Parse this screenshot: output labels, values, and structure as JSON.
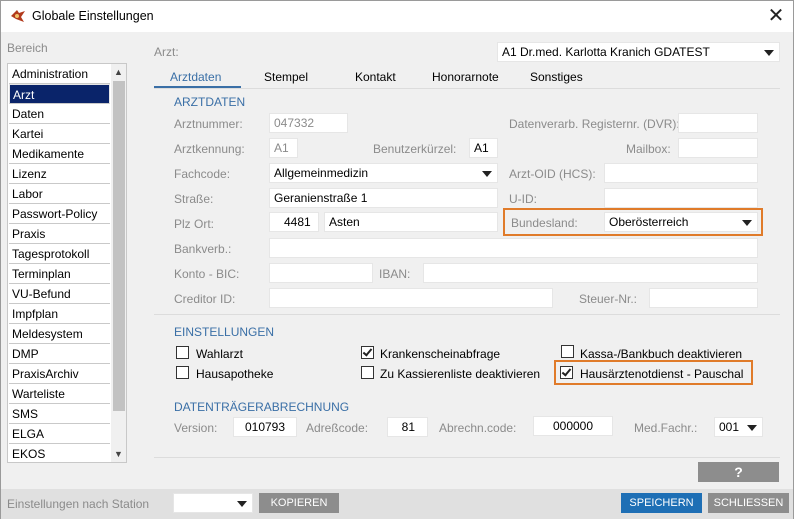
{
  "window": {
    "title": "Globale Einstellungen",
    "close_glyph": "✕"
  },
  "sidebar": {
    "heading": "Bereich",
    "items": [
      "Administration",
      "Arzt",
      "Daten",
      "Kartei",
      "Medikamente",
      "Lizenz",
      "Labor",
      "Passwort-Policy",
      "Praxis",
      "Tagesprotokoll",
      "Terminplan",
      "VU-Befund",
      "Impfplan",
      "Meldesystem",
      "DMP",
      "PraxisArchiv",
      "Warteliste",
      "SMS",
      "ELGA",
      "EKOS"
    ],
    "selected": "Arzt"
  },
  "arzt": {
    "label": "Arzt:",
    "value": "A1 Dr.med. Karlotta Kranich GDATEST"
  },
  "tabs": [
    "Arztdaten",
    "Stempel",
    "Kontakt",
    "Honorarnote",
    "Sonstiges"
  ],
  "arztdaten": {
    "section": "ARZTDATEN",
    "arztnummer": {
      "label": "Arztnummer:",
      "value": "047332"
    },
    "dvr": {
      "label": "Datenverarb. Registernr. (DVR):",
      "value": ""
    },
    "arztkennung": {
      "label": "Arztkennung:",
      "value": "A1"
    },
    "benutzerkuerzel": {
      "label": "Benutzerkürzel:",
      "value": "A1"
    },
    "mailbox": {
      "label": "Mailbox:",
      "value": ""
    },
    "fachcode": {
      "label": "Fachcode:",
      "value": "Allgemeinmedizin"
    },
    "arzt_oid": {
      "label": "Arzt-OID (HCS):",
      "value": ""
    },
    "strasse": {
      "label": "Straße:",
      "value": "Geranienstraße 1"
    },
    "uid": {
      "label": "U-ID:",
      "value": ""
    },
    "plz_ort": {
      "label": "Plz Ort:",
      "plz": "4481",
      "ort": "Asten"
    },
    "bundesland": {
      "label": "Bundesland:",
      "value": "Oberösterreich"
    },
    "bankverb": {
      "label": "Bankverb.:",
      "value": ""
    },
    "bic": {
      "label": "Konto - BIC:",
      "value": ""
    },
    "iban": {
      "label": "IBAN:",
      "value": ""
    },
    "creditor": {
      "label": "Creditor ID:",
      "value": ""
    },
    "steuer": {
      "label": "Steuer-Nr.:",
      "value": ""
    }
  },
  "einstellungen": {
    "section": "EINSTELLUNGEN",
    "wahlarzt": {
      "label": "Wahlarzt",
      "checked": false
    },
    "hausapotheke": {
      "label": "Hausapotheke",
      "checked": false
    },
    "krankenschein": {
      "label": "Krankenscheinabfrage",
      "checked": true
    },
    "kassierenliste": {
      "label": "Zu Kassierenliste deaktivieren",
      "checked": false
    },
    "kassabuch": {
      "label": "Kassa-/Bankbuch deaktivieren",
      "checked": false
    },
    "notdienst": {
      "label": "Hausärztenotdienst - Pauschal",
      "checked": true
    }
  },
  "datentraeger": {
    "section": "DATENTRÄGERABRECHNUNG",
    "version": {
      "label": "Version:",
      "value": "010793"
    },
    "adresscode": {
      "label": "Adreßcode:",
      "value": "81"
    },
    "abrechncode": {
      "label": "Abrechn.code:",
      "value": "000000"
    },
    "medfachr": {
      "label": "Med.Fachr.:",
      "value": "001"
    }
  },
  "help_label": "?",
  "footer": {
    "station_label": "Einstellungen nach Station",
    "station_value": "",
    "kopieren": "KOPIEREN",
    "speichern": "SPEICHERN",
    "schliessen": "SCHLIESSEN"
  },
  "colors": {
    "accent": "#3a6fa6",
    "highlight": "#e07b2a",
    "selection": "#0a246a",
    "button_blue": "#1e6fb5"
  }
}
